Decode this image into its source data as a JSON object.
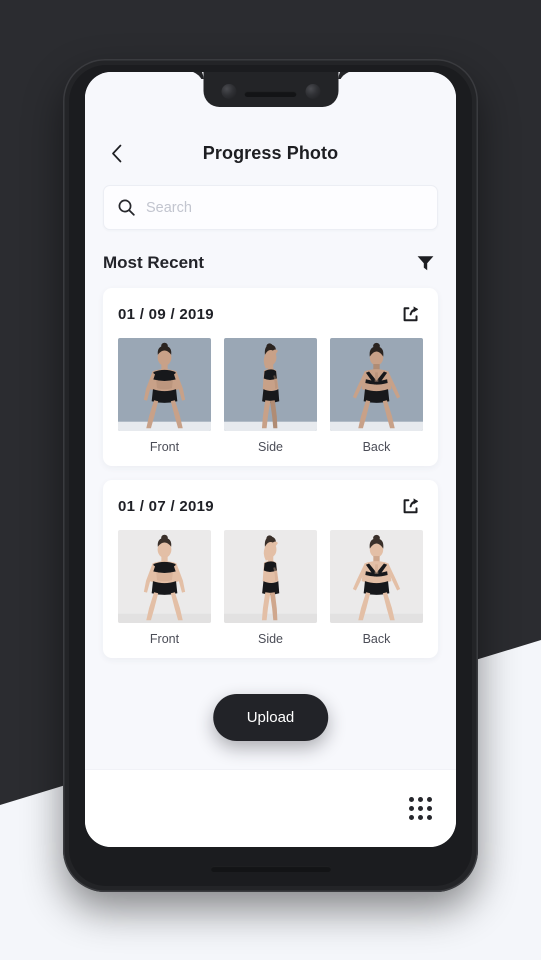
{
  "header": {
    "title": "Progress Photo",
    "back_icon": "chevron-left-icon"
  },
  "search": {
    "placeholder": "Search",
    "value": "",
    "icon": "search-icon"
  },
  "section": {
    "title": "Most Recent",
    "filter_icon": "filter-funnel-icon"
  },
  "cards": [
    {
      "date": "01 / 09 / 2019",
      "share_icon": "share-icon",
      "bg": "#9aa7b5",
      "floor": "#e7eaee",
      "skin": "#c8a188",
      "skin_shadow": "#b08c74",
      "hair": "#2b2420",
      "photos": [
        {
          "label": "Front",
          "pose": "front"
        },
        {
          "label": "Side",
          "pose": "side"
        },
        {
          "label": "Back",
          "pose": "back"
        }
      ]
    },
    {
      "date": "01 / 07 / 2019",
      "share_icon": "share-icon",
      "bg": "#ebeaea",
      "floor": "#e2e1e1",
      "skin": "#e3bfa6",
      "skin_shadow": "#cfa78d",
      "hair": "#3a302a",
      "photos": [
        {
          "label": "Front",
          "pose": "front"
        },
        {
          "label": "Side",
          "pose": "side"
        },
        {
          "label": "Back",
          "pose": "back"
        }
      ]
    }
  ],
  "upload": {
    "label": "Upload"
  },
  "bottom_bar": {
    "grid_icon": "apps-grid-icon"
  },
  "colors": {
    "backdrop_dark": "#2b2c30",
    "backdrop_light": "#f4f6fa",
    "screen_bg": "#f7f8fc",
    "card_bg": "#ffffff",
    "accent_dark": "#222328",
    "text_primary": "#1f2026",
    "text_muted": "#4b4d57",
    "placeholder": "#c2c5cf"
  }
}
